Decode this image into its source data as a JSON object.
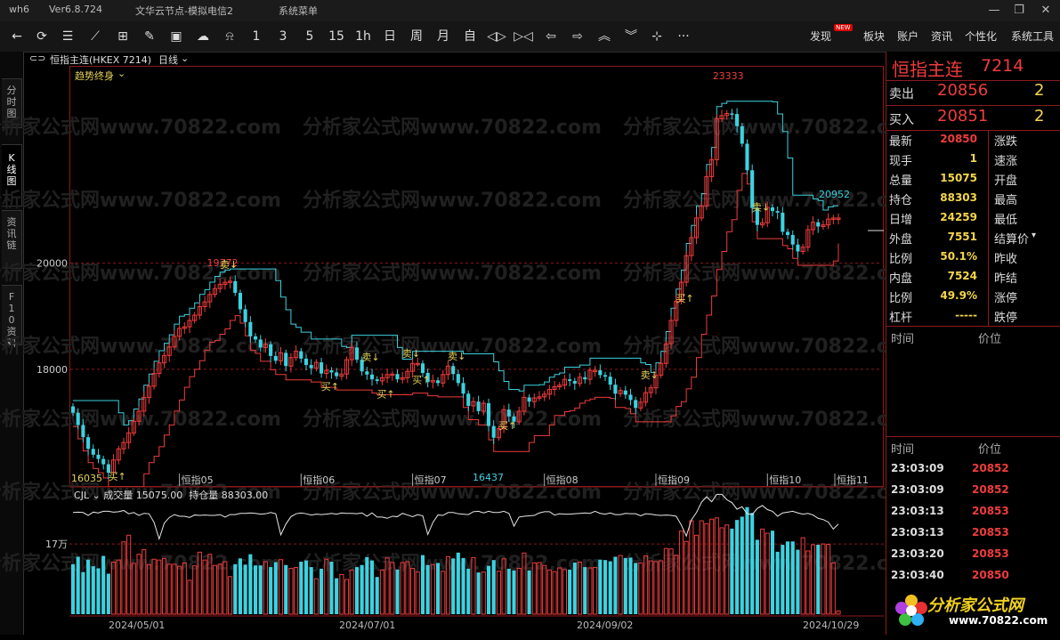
{
  "titlebar": {
    "app": "wh6",
    "version": "Ver6.8.724",
    "server": "文华云节点-模拟电信2",
    "menu": "系统菜单"
  },
  "toolbar": {
    "periods": [
      "1",
      "3",
      "5",
      "15",
      "1h",
      "日",
      "周",
      "月",
      "自"
    ],
    "more": "···",
    "right": [
      "发现",
      "板块",
      "账户",
      "资讯",
      "个性化",
      "系统工具"
    ],
    "badge": "NEW"
  },
  "tabs": [
    "分时图",
    "K线图",
    "资讯链",
    "F10资料"
  ],
  "chart_header": {
    "name": "恒指主连(HKEX 7214)",
    "period": "日线",
    "indicator": "趋势终身"
  },
  "chart_data": [
    {
      "type": "candlestick",
      "yticks": [
        18000,
        20000
      ],
      "ylim": [
        15800,
        23700
      ],
      "month_labels": [
        "恒指05",
        "恒指06",
        "恒指07",
        "恒指08",
        "恒指09",
        "恒指10",
        "恒指11"
      ],
      "annotations": {
        "high": "23333",
        "peak1": "19772",
        "low": "16437",
        "last": "20952",
        "start": "16035"
      },
      "signals": {
        "buy": "买",
        "sell": "卖"
      },
      "close": [
        17180,
        16950,
        16720,
        16500,
        16390,
        16310,
        16210,
        16050,
        16290,
        16500,
        16620,
        16800,
        17020,
        17210,
        17470,
        17680,
        17920,
        18120,
        18260,
        18420,
        18620,
        18770,
        18800,
        18920,
        19020,
        19180,
        19270,
        19410,
        19520,
        19600,
        19640,
        19660,
        19440,
        19130,
        18890,
        18620,
        18560,
        18410,
        18470,
        18250,
        18160,
        18310,
        18060,
        18220,
        18340,
        18200,
        18080,
        18020,
        18130,
        17920,
        17980,
        17940,
        17870,
        17910,
        18180,
        18410,
        18180,
        17960,
        17900,
        17810,
        17780,
        17840,
        17900,
        17910,
        17810,
        17840,
        17960,
        18110,
        18110,
        17930,
        17760,
        17790,
        17740,
        17900,
        18060,
        17910,
        17740,
        17540,
        17310,
        17390,
        17210,
        17360,
        16930,
        16710,
        16880,
        17240,
        17110,
        17010,
        17210,
        17470,
        17390,
        17460,
        17480,
        17530,
        17620,
        17670,
        17700,
        17810,
        17780,
        17730,
        17850,
        17810,
        17980,
        17980,
        17890,
        17860,
        17710,
        17540,
        17600,
        17520,
        17420,
        17270,
        17380,
        17560,
        17650,
        17890,
        18110,
        18480,
        18920,
        19280,
        19640,
        20140,
        20480,
        20850,
        21080,
        21630,
        21950,
        22720,
        22780,
        22820,
        22810,
        22580,
        22250,
        21750,
        21040,
        20720,
        20760,
        21050,
        20980,
        20950,
        20590,
        20530,
        20350,
        20220,
        20300,
        20630,
        20770,
        20690,
        20720,
        20830,
        20850,
        20850
      ],
      "vol": [
        12.1,
        13.9,
        10.2,
        13.2,
        11.6,
        11.1,
        14.1,
        9.8,
        12.6,
        13.1,
        17.5,
        19.1,
        12.3,
        14.5,
        15.6,
        12.0,
        13.3,
        13.1,
        13.5,
        12.1,
        12.1,
        11.6,
        12.4,
        8.2,
        11.7,
        15.0,
        13.1,
        14.5,
        11.8,
        12.1,
        12.7,
        9.1,
        12.1,
        13.5,
        12.0,
        14.5,
        11.8,
        11.8,
        12.7,
        11.4,
        12.6,
        13.2,
        11.9,
        11.1,
        11.3,
        12.7,
        13.0,
        11.4,
        8.6,
        11.0,
        13.3,
        12.7,
        8.7,
        9.6,
        8.4,
        10.7,
        11.4,
        11.9,
        13.8,
        13.0,
        9.0,
        10.7,
        13.6,
        12.5,
        10.8,
        12.5,
        12.7,
        11.1,
        10.2,
        14.3,
        11.9,
        12.0,
        12.4,
        10.4,
        13.9,
        13.5,
        14.9,
        13.6,
        11.0,
        13.7,
        10.1,
        10.2,
        11.7,
        13.1,
        10.4,
        13.4,
        11.0,
        10.6,
        11.1,
        14.8,
        10.6,
        12.4,
        12.5,
        11.8,
        10.7,
        10.3,
        11.2,
        10.8,
        10.8,
        12.5,
        12.6,
        11.4,
        11.2,
        11.3,
        13.2,
        13.1,
        12.8,
        13.9,
        14.2,
        13.6,
        13.7,
        12.4,
        12.4,
        14.1,
        12.9,
        12.7,
        12.9,
        15.9,
        15.8,
        14.2,
        20.1,
        17.6,
        22.6,
        19.1,
        22.6,
        21.9,
        23.0,
        23.3,
        20.9,
        21.6,
        20.7,
        22.8,
        23.6,
        25.9,
        24.5,
        18.0,
        20.6,
        19.6,
        20.2,
        15.1,
        16.8,
        17.6,
        17.6,
        15.6,
        18.5,
        15.3,
        16.8,
        16.8,
        17.0,
        16.9,
        12.4,
        0.8
      ],
      "oi": [
        24.6,
        24.7,
        24.6,
        23.9,
        24.7,
        24.5,
        24.9,
        24.9,
        24.7,
        24.8,
        25.1,
        24.3,
        24.6,
        23.9,
        24.4,
        24.3,
        22.2,
        18.2,
        22.0,
        23.4,
        24.1,
        23.7,
        23.7,
        23.4,
        24.0,
        23.9,
        24.0,
        23.9,
        23.9,
        24.1,
        23.5,
        24.1,
        24.1,
        24.4,
        24.4,
        24.5,
        24.4,
        24.2,
        24.3,
        24.6,
        24.3,
        19.2,
        21.8,
        23.6,
        24.3,
        24.5,
        24.3,
        24.0,
        24.2,
        24.1,
        24.2,
        24.4,
        24.2,
        24.5,
        24.4,
        24.4,
        24.3,
        24.5,
        23.7,
        24.5,
        23.5,
        23.5,
        23.2,
        23.7,
        23.6,
        24.4,
        24.0,
        23.6,
        24.1,
        23.8,
        19.3,
        22.2,
        24.0,
        23.9,
        24.6,
        24.6,
        24.3,
        24.2,
        24.1,
        24.8,
        24.9,
        24.5,
        24.9,
        24.6,
        24.6,
        24.9,
        24.4,
        21.3,
        23.5,
        23.7,
        23.8,
        23.9,
        24.5,
        24.8,
        24.8,
        24.0,
        24.3,
        24.2,
        24.2,
        24.3,
        24.4,
        24.5,
        24.4,
        24.9,
        24.4,
        24.2,
        24.5,
        24.1,
        24.1,
        24.4,
        24.3,
        24.3,
        23.8,
        24.3,
        24.2,
        24.0,
        23.9,
        24.0,
        23.9,
        23.7,
        21.6,
        18.9,
        22.8,
        24.6,
        27.1,
        28.4,
        27.2,
        29.0,
        29.0,
        27.7,
        27.0,
        25.4,
        26.0,
        24.3,
        24.1,
        25.6,
        26.3,
        25.3,
        24.9,
        23.7,
        24.5,
        24.7,
        24.9,
        24.5,
        24.2,
        24.4,
        24.0,
        23.2,
        22.9,
        22.3,
        20.6,
        21.8
      ],
      "vol_label": "成交量",
      "vol_value": "15075.00",
      "oi_label": "持仓量",
      "oi_value": "88303.00",
      "sub_name": "CJL",
      "sub_ytick": "17万",
      "date_labels": [
        "2024/05/01",
        "2024/07/01",
        "2024/09/02",
        "2024/10/29"
      ]
    }
  ],
  "quote": {
    "name": "恒指主连",
    "code": "7214",
    "sell_label": "卖出",
    "sell_price": "20856",
    "sell_qty": "2",
    "buy_label": "买入",
    "buy_price": "20851",
    "buy_qty": "2",
    "rows": [
      {
        "l": "最新",
        "v": "20850",
        "r": "涨跌"
      },
      {
        "l": "现手",
        "v": "1",
        "r": "速涨"
      },
      {
        "l": "总量",
        "v": "15075",
        "r": "开盘"
      },
      {
        "l": "持仓",
        "v": "88303",
        "r": "最高"
      },
      {
        "l": "日增",
        "v": "24259",
        "r": "最低"
      },
      {
        "l": "外盘",
        "v": "7551",
        "r": "结算价"
      },
      {
        "l": "比例",
        "v": "50.1%",
        "r": "昨收"
      },
      {
        "l": "内盘",
        "v": "7524",
        "r": "昨结"
      },
      {
        "l": "比例",
        "v": "49.9%",
        "r": "涨停"
      },
      {
        "l": "杠杆",
        "v": "-----",
        "r": "跌停"
      }
    ],
    "col_time": "时间",
    "col_price": "价位",
    "ticks": [
      {
        "t": "23:03:09",
        "p": "20852"
      },
      {
        "t": "23:03:09",
        "p": "20852"
      },
      {
        "t": "23:03:13",
        "p": "20853"
      },
      {
        "t": "23:03:13",
        "p": "20853"
      },
      {
        "t": "23:03:20",
        "p": "20853"
      },
      {
        "t": "23:03:40",
        "p": "20850"
      }
    ]
  },
  "watermark": "分析家公式网www.70822.com",
  "logo": {
    "text": "分析家公式网",
    "url": "www.70822.com"
  }
}
